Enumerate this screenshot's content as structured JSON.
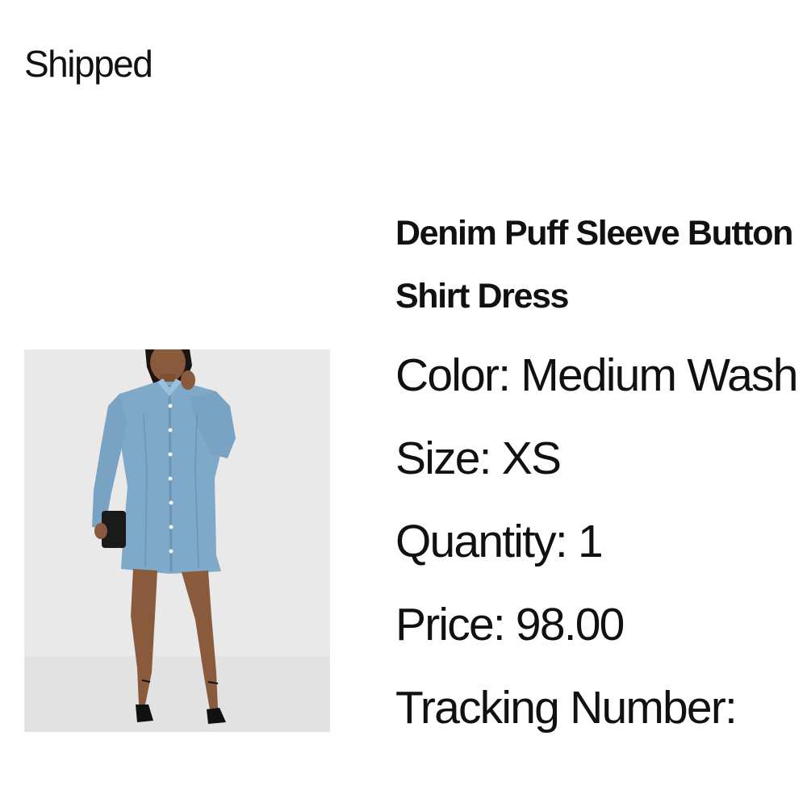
{
  "order": {
    "status": "Shipped"
  },
  "product": {
    "name_line1": "Denim Puff Sleeve Button",
    "name_line2": "Shirt Dress",
    "image_alt": "Model wearing a light blue denim puff sleeve shirt dress with black heels and a black clutch"
  },
  "details": {
    "color": "Color: Medium Wash",
    "size": "Size: XS",
    "quantity": "Quantity: 1",
    "price": "Price: 98.00",
    "tracking": "Tracking Number:"
  },
  "colors": {
    "text": "#111111",
    "background": "#ffffff",
    "photo_background": "#e9e9ea",
    "denim": "#7fa9c8"
  }
}
